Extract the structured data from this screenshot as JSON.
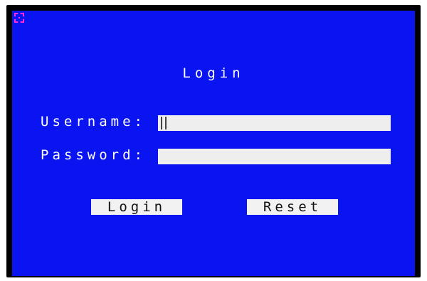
{
  "login_dialog": {
    "title": "Login",
    "username_label": "Username:",
    "password_label": "Password:",
    "username_value": "",
    "password_value": "",
    "login_button_label": "Login",
    "reset_button_label": "Reset"
  },
  "colors": {
    "background": "#0a14f0",
    "text": "#ffffff",
    "field": "#eeeeee",
    "corner_marker": "#ff2bd6"
  },
  "icons": {
    "corner": "corner-marker-icon"
  }
}
